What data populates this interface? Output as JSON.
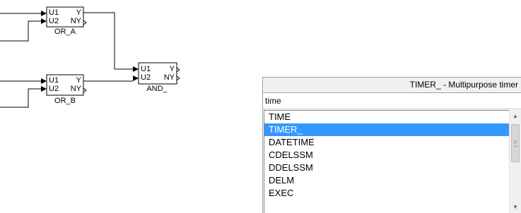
{
  "diagram": {
    "blocks": [
      {
        "name": "OR_A",
        "inputs": [
          "U1",
          "U2"
        ],
        "outputs": [
          "Y",
          "NY"
        ]
      },
      {
        "name": "OR_B",
        "inputs": [
          "U1",
          "U2"
        ],
        "outputs": [
          "Y",
          "NY"
        ]
      },
      {
        "name": "AND_",
        "inputs": [
          "U1",
          "U2"
        ],
        "outputs": [
          "Y",
          "NY"
        ]
      }
    ]
  },
  "popup": {
    "header": "TIMER_ - Multipurpose timer",
    "search_text": "time",
    "items": [
      "TIME",
      "TIMER_",
      "DATETIME",
      "CDELSSM",
      "DDELSSM",
      "DELM",
      "EXEC"
    ],
    "selected_item": "TIMER_",
    "selection_color": "#3399ff",
    "scroll_up_icon": "▲",
    "scroll_down_icon": "▼"
  }
}
